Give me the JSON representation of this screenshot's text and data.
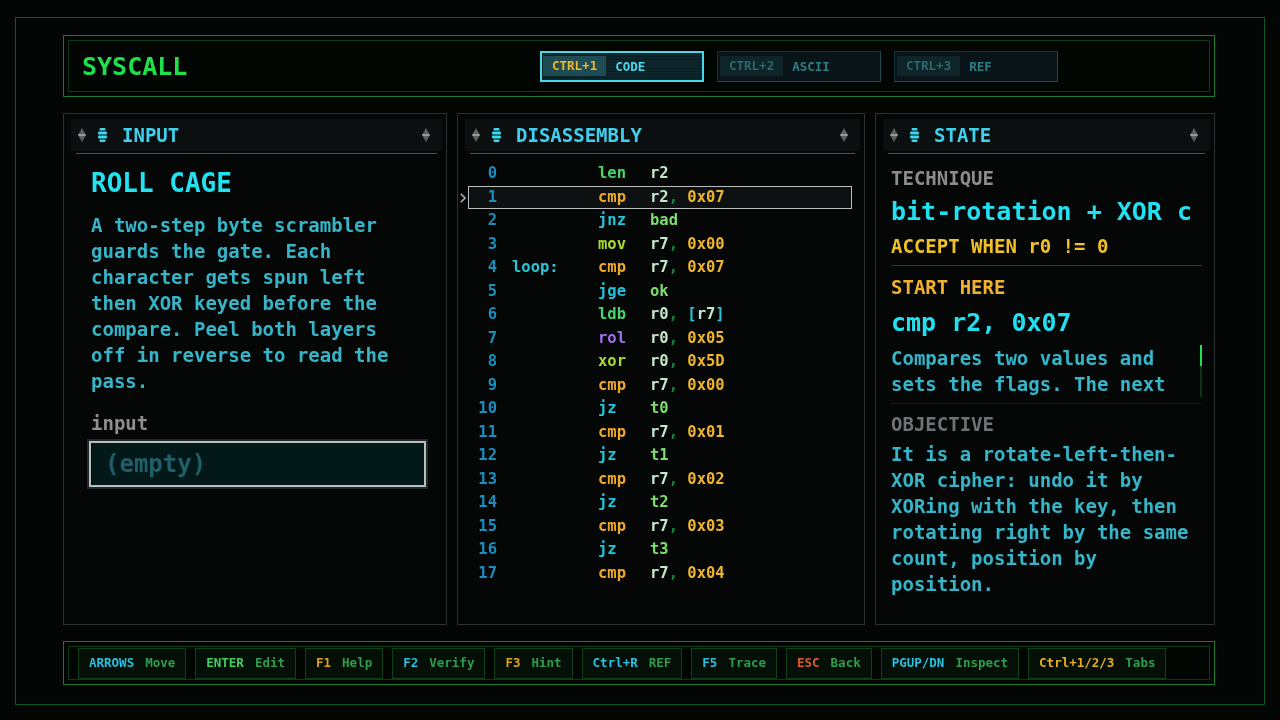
{
  "app": {
    "title": "SYSCALL"
  },
  "tabs": [
    {
      "key": "CTRL+1",
      "label": "CODE",
      "selected": true
    },
    {
      "key": "CTRL+2",
      "label": "ASCII",
      "selected": false
    },
    {
      "key": "CTRL+3",
      "label": "REF",
      "selected": false
    }
  ],
  "input_panel": {
    "title": "INPUT",
    "heading": "ROLL CAGE",
    "description": "A two-step byte scrambler guards the gate. Each character gets spun left then XOR keyed before the compare. Peel both layers off in reverse to read the pass.",
    "field_label": "input",
    "field": {
      "placeholder": "(empty)"
    }
  },
  "disassembly": {
    "title": "DISASSEMBLY",
    "rows": [
      {
        "number": "0",
        "mnemonic": "len",
        "color": "#44d86c",
        "selected": false,
        "operands": [
          {
            "text": "r2",
            "kind": "register"
          }
        ]
      },
      {
        "number": "1",
        "mnemonic": "cmp",
        "color": "#f0a828",
        "selected": true,
        "operands": [
          {
            "text": "r2",
            "kind": "register"
          },
          {
            "text": ", ",
            "kind": "separator"
          },
          {
            "text": "0x07",
            "kind": "immediate"
          }
        ]
      },
      {
        "number": "2",
        "mnemonic": "jnz",
        "color": "#22c4dc",
        "selected": false,
        "operands": [
          {
            "text": "bad",
            "kind": "target"
          }
        ]
      },
      {
        "number": "3",
        "mnemonic": "mov",
        "color": "#a8dc2c",
        "selected": false,
        "operands": [
          {
            "text": "r7",
            "kind": "register"
          },
          {
            "text": ", ",
            "kind": "separator"
          },
          {
            "text": "0x00",
            "kind": "immediate"
          }
        ]
      },
      {
        "number": "4",
        "label": "loop:",
        "mnemonic": "cmp",
        "color": "#f0a828",
        "selected": false,
        "operands": [
          {
            "text": "r7",
            "kind": "register"
          },
          {
            "text": ", ",
            "kind": "separator"
          },
          {
            "text": "0x07",
            "kind": "immediate"
          }
        ]
      },
      {
        "number": "5",
        "mnemonic": "jge",
        "color": "#22c4dc",
        "selected": false,
        "operands": [
          {
            "text": "ok",
            "kind": "target"
          }
        ]
      },
      {
        "number": "6",
        "mnemonic": "ldb",
        "color": "#44d86c",
        "selected": false,
        "operands": [
          {
            "text": "r0",
            "kind": "register"
          },
          {
            "text": ", ",
            "kind": "separator"
          },
          {
            "text": "[r7]",
            "kind": "memory"
          }
        ]
      },
      {
        "number": "7",
        "mnemonic": "rol",
        "color": "#a070e8",
        "selected": false,
        "operands": [
          {
            "text": "r0",
            "kind": "register"
          },
          {
            "text": ", ",
            "kind": "separator"
          },
          {
            "text": "0x05",
            "kind": "immediate"
          }
        ]
      },
      {
        "number": "8",
        "mnemonic": "xor",
        "color": "#a8dc2c",
        "selected": false,
        "operands": [
          {
            "text": "r0",
            "kind": "register"
          },
          {
            "text": ", ",
            "kind": "separator"
          },
          {
            "text": "0x5D",
            "kind": "immediate"
          }
        ]
      },
      {
        "number": "9",
        "mnemonic": "cmp",
        "color": "#f0a828",
        "selected": false,
        "operands": [
          {
            "text": "r7",
            "kind": "register"
          },
          {
            "text": ", ",
            "kind": "separator"
          },
          {
            "text": "0x00",
            "kind": "immediate"
          }
        ]
      },
      {
        "number": "10",
        "mnemonic": "jz",
        "color": "#22c4dc",
        "selected": false,
        "operands": [
          {
            "text": "t0",
            "kind": "target"
          }
        ]
      },
      {
        "number": "11",
        "mnemonic": "cmp",
        "color": "#f0a828",
        "selected": false,
        "operands": [
          {
            "text": "r7",
            "kind": "register"
          },
          {
            "text": ", ",
            "kind": "separator"
          },
          {
            "text": "0x01",
            "kind": "immediate"
          }
        ]
      },
      {
        "number": "12",
        "mnemonic": "jz",
        "color": "#22c4dc",
        "selected": false,
        "operands": [
          {
            "text": "t1",
            "kind": "target"
          }
        ]
      },
      {
        "number": "13",
        "mnemonic": "cmp",
        "color": "#f0a828",
        "selected": false,
        "operands": [
          {
            "text": "r7",
            "kind": "register"
          },
          {
            "text": ", ",
            "kind": "separator"
          },
          {
            "text": "0x02",
            "kind": "immediate"
          }
        ]
      },
      {
        "number": "14",
        "mnemonic": "jz",
        "color": "#22c4dc",
        "selected": false,
        "operands": [
          {
            "text": "t2",
            "kind": "target"
          }
        ]
      },
      {
        "number": "15",
        "mnemonic": "cmp",
        "color": "#f0a828",
        "selected": false,
        "operands": [
          {
            "text": "r7",
            "kind": "register"
          },
          {
            "text": ", ",
            "kind": "separator"
          },
          {
            "text": "0x03",
            "kind": "immediate"
          }
        ]
      },
      {
        "number": "16",
        "mnemonic": "jz",
        "color": "#22c4dc",
        "selected": false,
        "operands": [
          {
            "text": "t3",
            "kind": "target"
          }
        ]
      },
      {
        "number": "17",
        "mnemonic": "cmp",
        "color": "#f0a828",
        "selected": false,
        "operands": [
          {
            "text": "r7",
            "kind": "register"
          },
          {
            "text": ", ",
            "kind": "separator"
          },
          {
            "text": "0x04",
            "kind": "immediate"
          }
        ]
      }
    ]
  },
  "state_panel": {
    "title": "STATE",
    "technique_label": "TECHNIQUE",
    "technique": "bit-rotation + XOR c",
    "accept": "ACCEPT WHEN r0 != 0",
    "start_label": "START HERE",
    "start_instruction": "cmp r2, 0x07",
    "instruction_help": "Compares two values and sets the flags. The next",
    "objective_label": "OBJECTIVE",
    "objective": "It is a rotate-left-then-XOR cipher: undo it by XORing with the key, then rotating right by the same count, position by position."
  },
  "key_hints": [
    {
      "key": "ARROWS",
      "action": "Move",
      "color": "#28c0e0"
    },
    {
      "key": "ENTER",
      "action": "Edit",
      "color": "#40d060"
    },
    {
      "key": "F1",
      "action": "Help",
      "color": "#e0a020"
    },
    {
      "key": "F2",
      "action": "Verify",
      "color": "#28c0e0"
    },
    {
      "key": "F3",
      "action": "Hint",
      "color": "#e0a020"
    },
    {
      "key": "Ctrl+R",
      "action": "REF",
      "color": "#28c0e0"
    },
    {
      "key": "F5",
      "action": "Trace",
      "color": "#28c0e0"
    },
    {
      "key": "ESC",
      "action": "Back",
      "color": "#e05a30"
    },
    {
      "key": "PGUP/DN",
      "action": "Inspect",
      "color": "#28c0e0"
    },
    {
      "key": "Ctrl+1/2/3",
      "action": "Tabs",
      "color": "#e8b020"
    }
  ]
}
